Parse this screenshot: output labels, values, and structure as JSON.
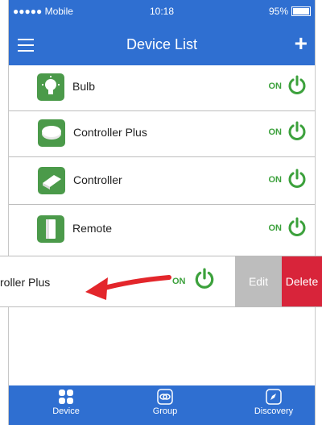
{
  "status_bar": {
    "carrier": "●●●●● Mobile",
    "time": "10:18",
    "battery": "95%"
  },
  "nav": {
    "title": "Device List",
    "menu_icon": "hamburger-menu-icon",
    "add_icon": "plus-icon"
  },
  "devices": [
    {
      "name": "Bulb",
      "state": "ON",
      "icon": "bulb-icon"
    },
    {
      "name": "Controller Plus",
      "state": "ON",
      "icon": "controller-plus-icon"
    },
    {
      "name": "Controller",
      "state": "ON",
      "icon": "controller-icon"
    },
    {
      "name": "Remote",
      "state": "ON",
      "icon": "remote-icon"
    }
  ],
  "swiped_row": {
    "name": "roller Plus",
    "state": "ON",
    "edit_label": "Edit",
    "delete_label": "Delete"
  },
  "tabs": [
    {
      "label": "Device",
      "icon": "grid-icon"
    },
    {
      "label": "Group",
      "icon": "link-icon"
    },
    {
      "label": "Discovery",
      "icon": "compass-icon"
    }
  ],
  "colors": {
    "header_blue": "#2f6fd1",
    "on_green": "#3ca13c",
    "delete_red": "#d8243a",
    "edit_gray": "#bdbdbd"
  }
}
